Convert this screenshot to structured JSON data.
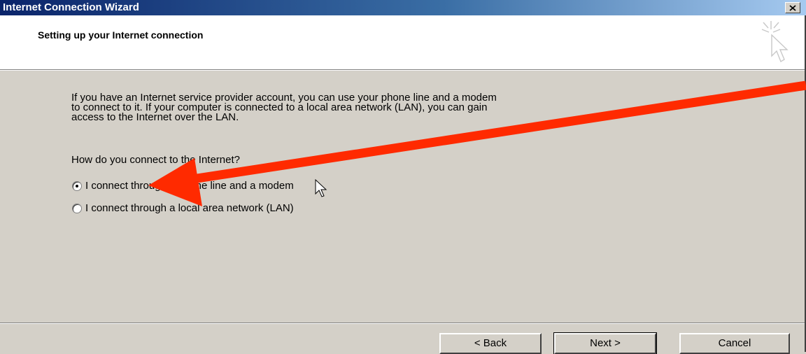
{
  "window": {
    "title": "Internet Connection Wizard",
    "close_icon": "close-icon"
  },
  "header": {
    "title": "Setting up your Internet connection",
    "icon": "wizard-cursor-icon"
  },
  "intro": {
    "line1": "If you have an Internet service provider account, you can use your phone line and a modem",
    "line2": "to connect to it. If your computer is connected to a local area network (LAN), you can gain",
    "line3": "access to the Internet over the LAN."
  },
  "question": "How do you connect to the Internet?",
  "options": [
    {
      "label": "I connect through a phone line and a modem",
      "selected": true
    },
    {
      "label": "I connect through a local area network (LAN)",
      "selected": false
    }
  ],
  "buttons": {
    "back": "< Back",
    "next": "Next >",
    "cancel": "Cancel"
  },
  "annotation": {
    "arrow_color": "#ff2a00"
  }
}
